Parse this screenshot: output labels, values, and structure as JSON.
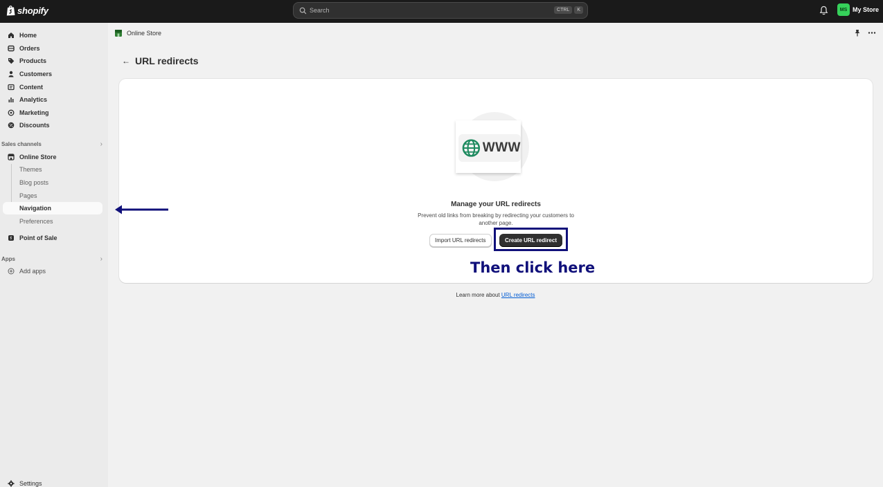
{
  "topbar": {
    "logo_text": "shopify",
    "search_placeholder": "Search",
    "shortcut_keys": [
      "CTRL",
      "K"
    ],
    "store_initials": "MS",
    "store_name": "My Store"
  },
  "sidebar": {
    "main_items": [
      {
        "label": "Home",
        "icon": "home-icon"
      },
      {
        "label": "Orders",
        "icon": "orders-icon"
      },
      {
        "label": "Products",
        "icon": "tag-icon"
      },
      {
        "label": "Customers",
        "icon": "person-icon"
      },
      {
        "label": "Content",
        "icon": "content-icon"
      },
      {
        "label": "Analytics",
        "icon": "bar-chart-icon"
      },
      {
        "label": "Marketing",
        "icon": "target-icon"
      },
      {
        "label": "Discounts",
        "icon": "discount-icon"
      }
    ],
    "sales_channels_header": "Sales channels",
    "online_store": "Online Store",
    "online_store_subitems": [
      "Themes",
      "Blog posts",
      "Pages",
      "Navigation",
      "Preferences"
    ],
    "active_subitem": "Navigation",
    "point_of_sale": "Point of Sale",
    "apps_header": "Apps",
    "add_apps": "Add apps",
    "settings": "Settings"
  },
  "main": {
    "breadcrumb": "Online Store",
    "page_title": "URL redirects",
    "empty_state": {
      "illustration_text": "WWW",
      "title": "Manage your URL redirects",
      "description": "Prevent old links from breaking by redirecting your customers to another page.",
      "secondary_button": "Import URL redirects",
      "primary_button": "Create URL redirect"
    },
    "learn_more_prefix": "Learn more about",
    "learn_more_link": "URL redirects"
  },
  "annotations": {
    "callout_text": "Then click here",
    "color": "#10107a"
  },
  "colors": {
    "topbar_bg": "#1a1a1a",
    "primary_button": "#303030",
    "link": "#005bd3",
    "avatar": "#36d15a"
  }
}
